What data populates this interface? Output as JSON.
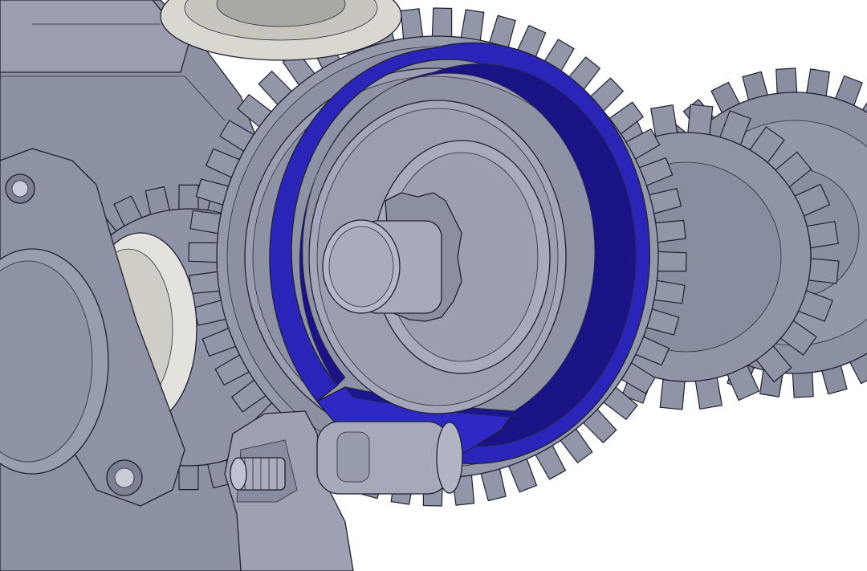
{
  "scene": {
    "colors": {
      "background": "#ffffff",
      "part_gray": "#8f93a6",
      "part_gray_light": "#a9adbd",
      "part_gray_dark": "#6f7386",
      "edge": "#1e2030",
      "highlight_blue": "#2a24b8",
      "highlight_blue_dark": "#191385",
      "bearing_white": "#e4e2dc"
    },
    "components": [
      "chassis-housing",
      "drive-gear-large",
      "drive-gear-right",
      "drive-gear-far-right",
      "pinion-gear-left",
      "highlighted-brake-band",
      "center-hub",
      "shaft-stub",
      "bearing-top",
      "bearing-left",
      "linkage-arm",
      "threaded-pin"
    ]
  }
}
